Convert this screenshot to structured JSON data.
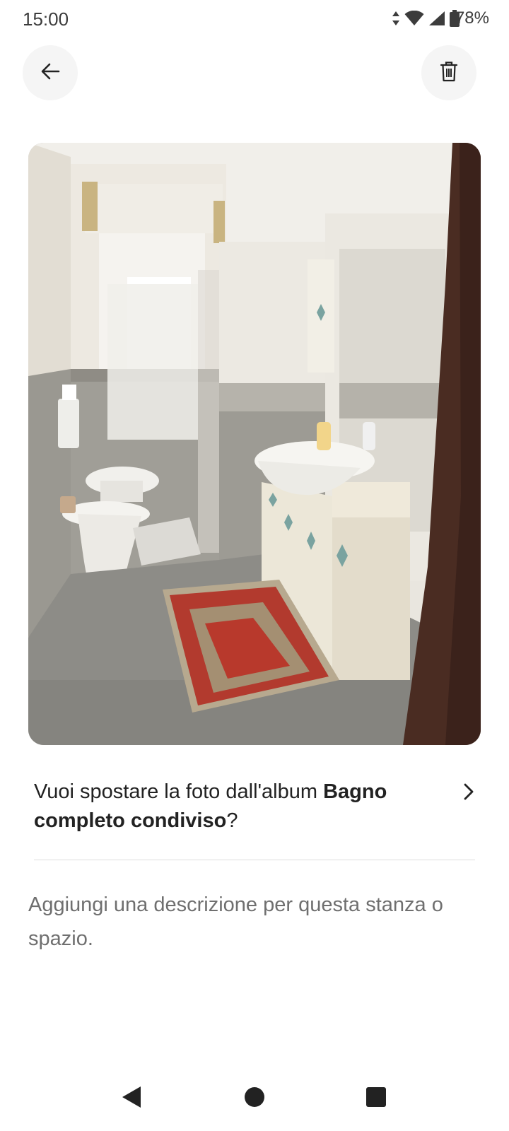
{
  "status_bar": {
    "time": "15:00",
    "battery": "78%",
    "icons": [
      "data-arrows-icon",
      "wifi-icon",
      "signal-icon",
      "battery-icon"
    ]
  },
  "toolbar": {
    "back_icon": "arrow-left-icon",
    "delete_icon": "trash-icon"
  },
  "photo": {
    "subject": "bathroom-photo"
  },
  "move_album": {
    "prefix": "Vuoi spostare la foto dall'album ",
    "album_name": "Bagno completo condiviso",
    "suffix": "?",
    "icon": "chevron-right-icon"
  },
  "description": {
    "placeholder": "Aggiungi una descrizione per questa stanza o spazio."
  },
  "nav_bar": {
    "icons": [
      "nav-back-icon",
      "nav-home-icon",
      "nav-recents-icon"
    ]
  },
  "colors": {
    "button_bg": "#f5f5f5",
    "text_primary": "#222222",
    "text_secondary": "#6f6f6f",
    "divider": "#dddddd"
  }
}
